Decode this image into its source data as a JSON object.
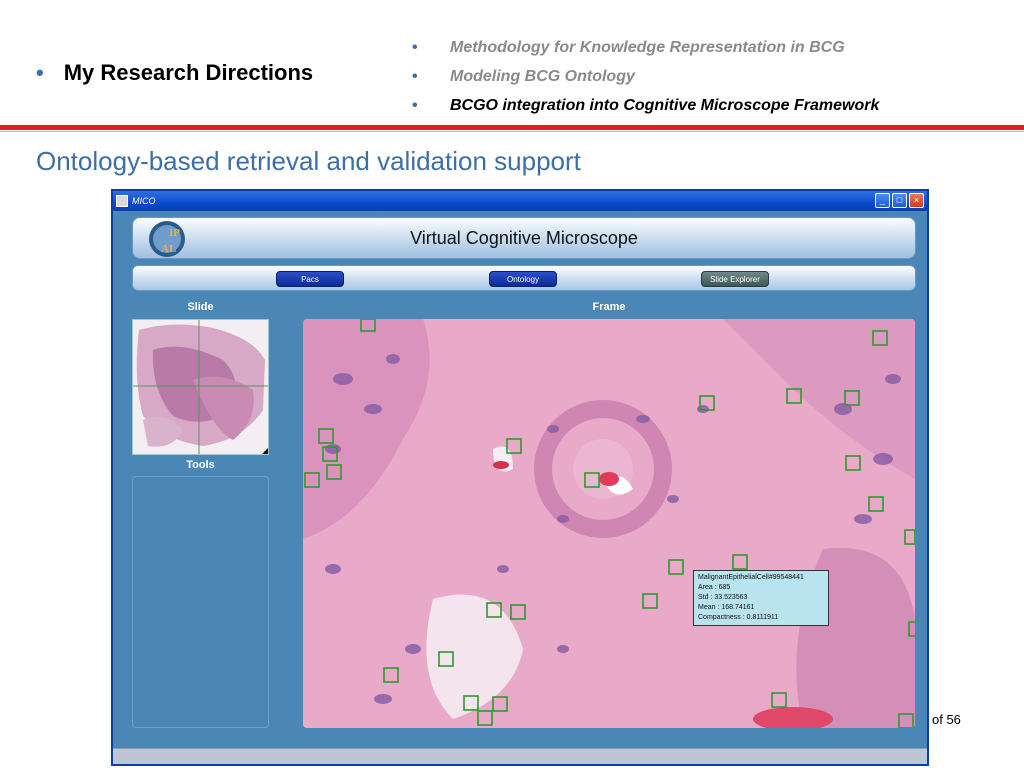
{
  "header": {
    "main_bullet": "My Research Directions",
    "sub_bullets": [
      {
        "label": "Methodology for Knowledge Representation in BCG",
        "active": false
      },
      {
        "label": "Modeling BCG Ontology",
        "active": false
      },
      {
        "label": "BCGO integration into Cognitive Microscope Framework",
        "active": true
      }
    ],
    "bullet_glyph": "•",
    "accent_color": "#e21f26",
    "title_color": "#3c6ea8"
  },
  "section_title": "Ontology-based retrieval and validation support",
  "page_number": "of 56",
  "app": {
    "window_title": "MICO",
    "banner_title": "Virtual Cognitive Microscope",
    "logo_text": "IPAL",
    "nav_buttons": [
      "Pacs",
      "Ontology",
      "Slide Explorer"
    ],
    "slide_label": "Slide",
    "frame_label": "Frame",
    "tools_label": "Tools",
    "window_controls": [
      "minimize-icon",
      "maximize-icon",
      "close-icon"
    ],
    "tooltip": {
      "name": "MalignantEpithelialCell#99548441",
      "area": "Area : 685",
      "std": "Std : 33.523563",
      "mean": "Mean : 168.74161",
      "compactness": "Compactness : 0.8111911"
    }
  }
}
